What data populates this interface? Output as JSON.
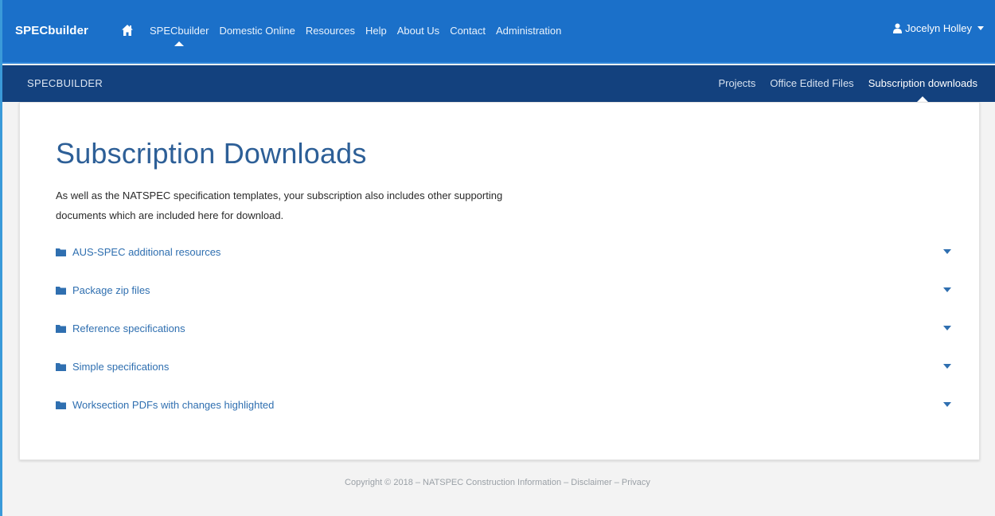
{
  "topnav": {
    "brand": "SPECbuilder",
    "home_icon": "home-icon",
    "links": [
      {
        "label": "SPECbuilder",
        "active": true
      },
      {
        "label": "Domestic Online",
        "active": false
      },
      {
        "label": "Resources",
        "active": false
      },
      {
        "label": "Help",
        "active": false
      },
      {
        "label": "About Us",
        "active": false
      },
      {
        "label": "Contact",
        "active": false
      },
      {
        "label": "Administration",
        "active": false
      }
    ],
    "user_name": "Jocelyn Holley"
  },
  "subnav": {
    "title": "SPECBUILDER",
    "links": [
      {
        "label": "Projects",
        "active": false
      },
      {
        "label": "Office Edited Files",
        "active": false
      },
      {
        "label": "Subscription downloads",
        "active": true
      }
    ]
  },
  "main": {
    "heading": "Subscription Downloads",
    "intro_line1": "As well as the NATSPEC specification templates, your subscription also includes other supporting",
    "intro_line2": "documents which are included here for download.",
    "items": [
      {
        "label": "AUS-SPEC additional resources",
        "icon": "folder-icon"
      },
      {
        "label": "Package zip files",
        "icon": "folder-icon"
      },
      {
        "label": "Reference specifications",
        "icon": "folder-icon"
      },
      {
        "label": "Simple specifications",
        "icon": "folder-icon"
      },
      {
        "label": "Worksection PDFs with changes highlighted",
        "icon": "folder-icon"
      }
    ]
  },
  "footer": {
    "text": "Copyright © 2018 – NATSPEC Construction Information – Disclaimer – Privacy"
  },
  "colors": {
    "topbar": "#1b70c9",
    "subbar": "#13417e",
    "heading": "#2d5f97",
    "link": "#2f6fb0"
  }
}
